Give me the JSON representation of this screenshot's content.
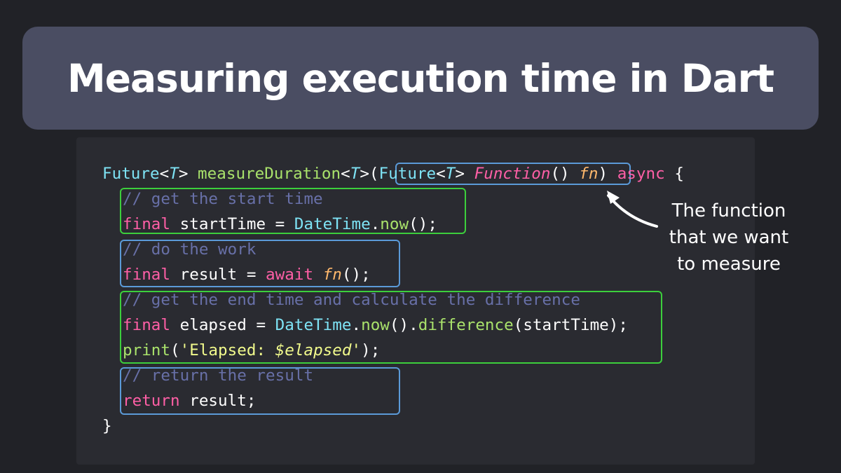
{
  "title": "Measuring execution time in Dart",
  "annotation": {
    "line1": "The function",
    "line2": "that we want",
    "line3": "to measure"
  },
  "code": {
    "signature": {
      "future": "Future",
      "lt1": "<",
      "t1": "T",
      "gt1": ">",
      "name": " measureDuration",
      "lt2": "<",
      "t2": "T",
      "gt2": ">(",
      "param_future": "Future",
      "lt3": "<",
      "t3": "T",
      "gt3": ">",
      "function_kw": "Function",
      "parens": "()",
      "param_name": "fn",
      "close": ")",
      "async": "async",
      "brace": "{"
    },
    "comment_start": "// get the start time",
    "line_start": {
      "final": "final",
      "var": " startTime = ",
      "cls": "DateTime",
      "dot": ".",
      "fn": "now",
      "end": "();"
    },
    "comment_work": "// do the work",
    "line_work": {
      "final": "final",
      "var": " result = ",
      "await": "await",
      "fn": "fn",
      "end": "();"
    },
    "comment_end": "// get the end time and calculate the difference",
    "line_elapsed": {
      "final": "final",
      "var": " elapsed = ",
      "cls": "DateTime",
      "dot1": ".",
      "fn1": "now",
      "mid": "().",
      "fn2": "difference",
      "end": "(startTime);"
    },
    "line_print": {
      "fn": "print",
      "open": "(",
      "str1": "'Elapsed: ",
      "strv": "$elapsed",
      "str2": "'",
      "end": ");"
    },
    "comment_return": "// return the result",
    "line_return": {
      "kw": "return",
      "rest": " result;"
    },
    "closing": "}"
  },
  "colors": {
    "background": "#212227",
    "banner": "#4a4d62",
    "code_panel": "#2a2b31",
    "class": "#7ee3f5",
    "function": "#a9e26b",
    "keyword": "#ff5fa6",
    "parameter": "#ffb86c",
    "comment": "#6870a8",
    "string": "#f1fa8c",
    "highlight_blue": "#5b9ad8",
    "highlight_green": "#3ccf3c"
  }
}
